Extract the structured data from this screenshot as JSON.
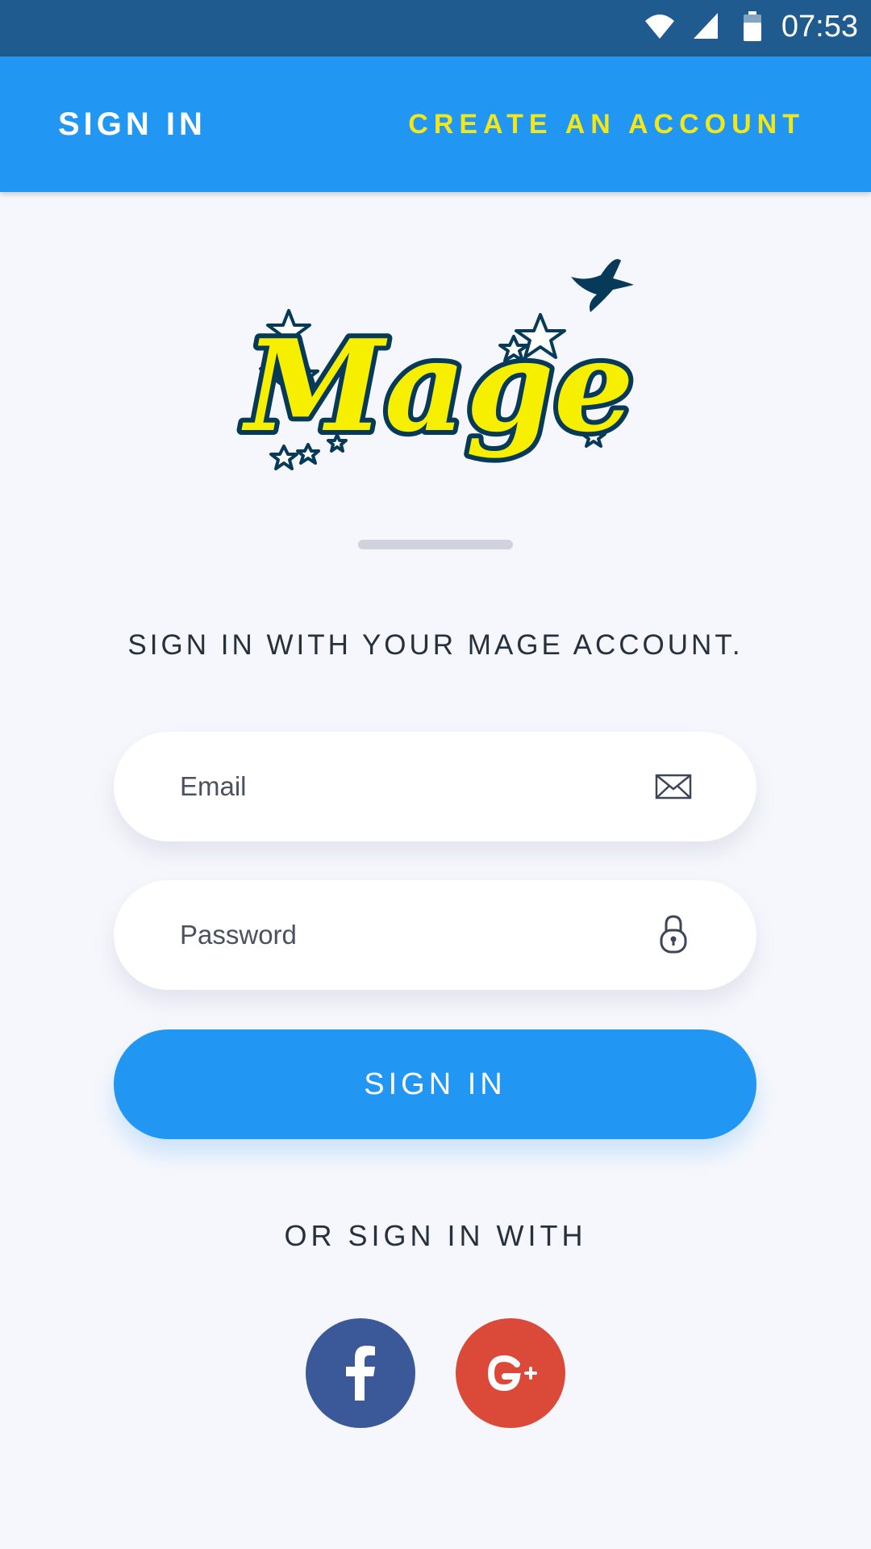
{
  "status_bar": {
    "time": "07:53",
    "icons": [
      "wifi-icon",
      "cellular-signal-icon",
      "battery-icon"
    ]
  },
  "app_bar": {
    "tab_signin": "SIGN IN",
    "tab_create_account": "CREATE AN ACCOUNT"
  },
  "logo": {
    "text": "Mage"
  },
  "form": {
    "headline": "SIGN IN WITH YOUR MAGE ACCOUNT.",
    "email_placeholder": "Email",
    "email_value": "",
    "password_placeholder": "Password",
    "password_value": "",
    "submit_label": "SIGN IN",
    "social_heading": "OR SIGN IN WITH"
  },
  "social_buttons": [
    {
      "name": "facebook",
      "icon": "facebook-icon",
      "color": "#3b5998"
    },
    {
      "name": "google-plus",
      "icon": "google-plus-icon",
      "color": "#db4a39"
    }
  ],
  "colors": {
    "primary": "#2196f3",
    "status_bar": "#1f5b8e",
    "accent_yellow": "#f5e615",
    "logo_dark": "#073a58",
    "background": "#f6f7fc"
  }
}
